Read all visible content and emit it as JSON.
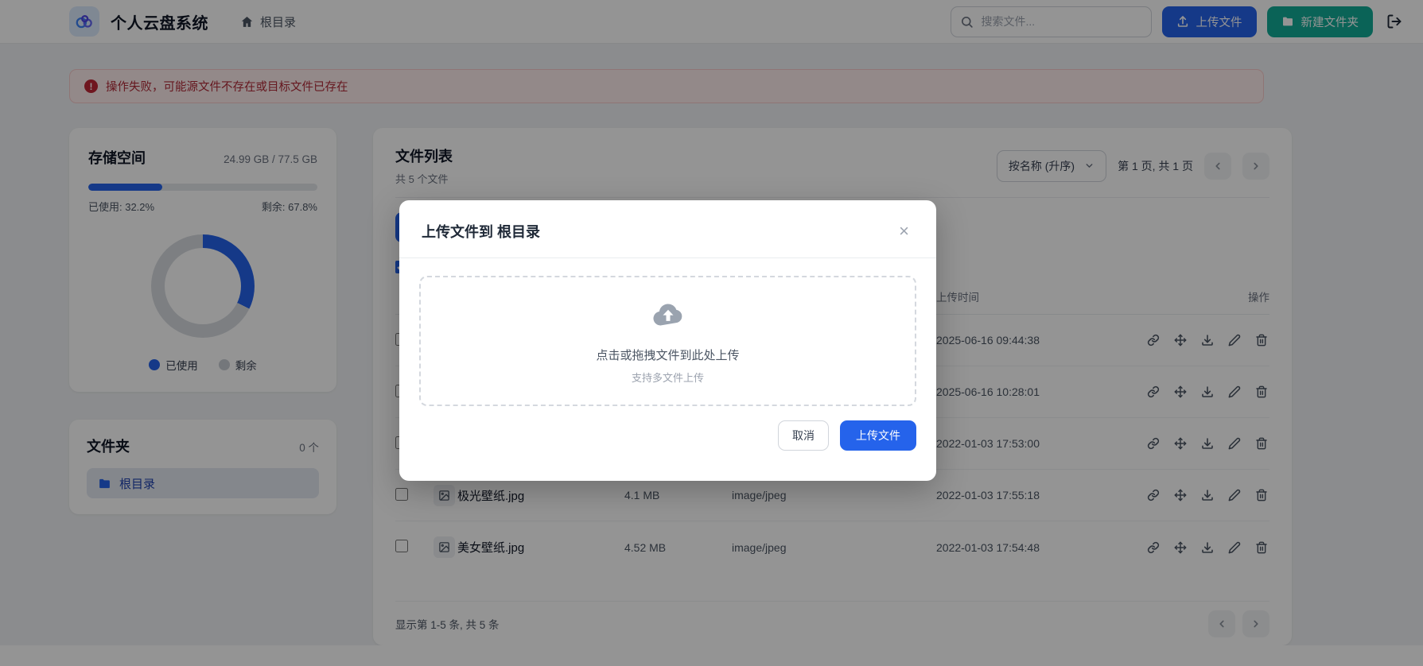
{
  "navbar": {
    "app_title": "个人云盘系统",
    "breadcrumb": "根目录",
    "search_placeholder": "搜索文件...",
    "upload_button": "上传文件",
    "new_folder_button": "新建文件夹"
  },
  "alert": {
    "icon": "!",
    "message": "操作失败，可能源文件不存在或目标文件已存在"
  },
  "storage": {
    "title": "存储空间",
    "usage_text": "24.99 GB / 77.5 GB",
    "used_text": "已使用: 32.2%",
    "free_text": "剩余: 67.8%",
    "used_percent": 32.2,
    "free_percent": 67.8,
    "legend": {
      "used": "已使用",
      "free": "剩余"
    },
    "colors": {
      "used": "#2563eb",
      "free": "#d7dbe0"
    }
  },
  "folders": {
    "title": "文件夹",
    "count": "0 个",
    "items": [
      {
        "label": "根目录"
      }
    ]
  },
  "file_list": {
    "title": "文件列表",
    "subtitle": "共 5 个文件",
    "sort_selected": "按名称 (升序)",
    "page_info": "第 1 页, 共 1 页",
    "headers": {
      "upload_time": "上传时间",
      "actions": "操作"
    },
    "rows": [
      {
        "name": "",
        "size": "",
        "type": "",
        "uploaded": "2025-06-16 09:44:38"
      },
      {
        "name": "",
        "size": "",
        "type": "",
        "uploaded": "2025-06-16 10:28:01"
      },
      {
        "name": "",
        "size": "",
        "type": "",
        "uploaded": "2022-01-03 17:53:00"
      },
      {
        "name": "极光壁纸.jpg",
        "size": "4.1 MB",
        "type": "image/jpeg",
        "uploaded": "2022-01-03 17:55:18"
      },
      {
        "name": "美女壁纸.jpg",
        "size": "4.52 MB",
        "type": "image/jpeg",
        "uploaded": "2022-01-03 17:54:48"
      }
    ],
    "footer_text": "显示第 1-5 条, 共 5 条"
  },
  "upload_modal": {
    "title": "上传文件到 根目录",
    "close_glyph": "×",
    "dropzone_main": "点击或拖拽文件到此处上传",
    "dropzone_hint": "支持多文件上传",
    "cancel_button": "取消",
    "confirm_button": "上传文件"
  }
}
